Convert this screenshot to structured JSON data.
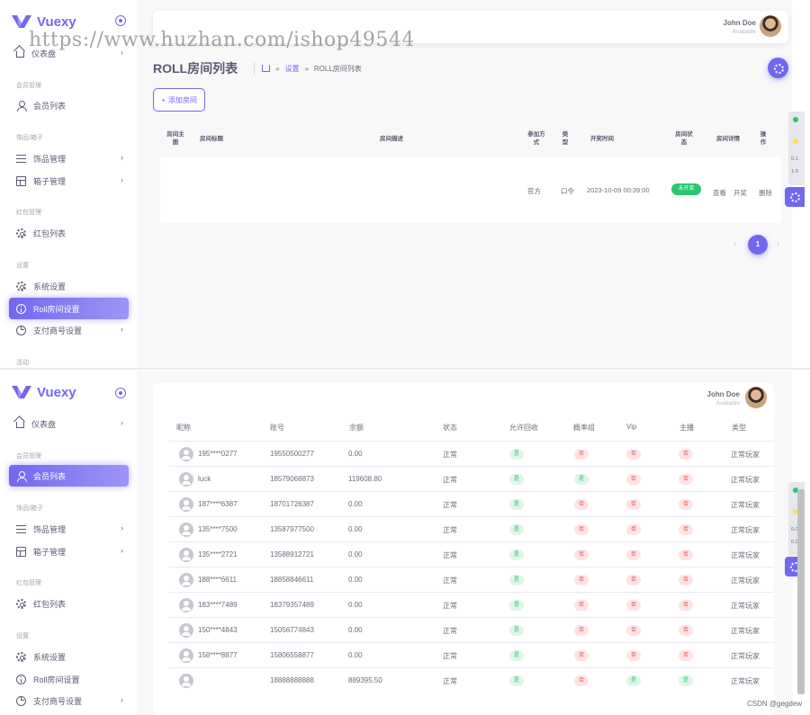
{
  "brand": {
    "name": "Vuexy",
    "color": "#7367f0"
  },
  "watermark": "https://www.huzhan.com/ishop49544",
  "csdn_mark": "CSDN @gegdew",
  "user": {
    "name": "John Doe",
    "status": "Available"
  },
  "top_panel": {
    "sidebar": {
      "dashboard": "仪表盘",
      "sections": {
        "members": "会员管理",
        "goods": "饰品/箱子",
        "redpack": "红包管理",
        "settings": "设置"
      },
      "items": {
        "member_list": "会员列表",
        "goods_manage": "饰品管理",
        "box_manage": "箱子管理",
        "redpack_list": "红包列表",
        "system_settings": "系统设置",
        "roll_settings": "Roll房间设置",
        "payment_settings": "支付商号设置"
      },
      "trailing_section": "活动"
    },
    "page_title": "ROLL房间列表",
    "breadcrumb": {
      "link": "设置",
      "current": "ROLL房间列表"
    },
    "add_button": "添加房间",
    "table": {
      "headers": {
        "owner": "房间主图",
        "title": "房间标题",
        "desc": "房间描述",
        "mode": "参加方式",
        "type": "类型",
        "time": "开奖时间",
        "status": "房间状态",
        "detail": "房间详情",
        "ops": "操作"
      },
      "row": {
        "mode": "官方",
        "type": "口令",
        "time": "2023-10-09 00:39:00",
        "status": "未开奖",
        "ops": {
          "view": "查看",
          "draw": "开奖",
          "delete": "删除"
        }
      }
    },
    "pagination": {
      "current": "1",
      "prev": "‹",
      "next": "›"
    },
    "side_tools": {
      "nums": [
        "0.1",
        "1.0"
      ]
    }
  },
  "bottom_panel": {
    "sidebar": {
      "dashboard": "仪表盘",
      "sections": {
        "members": "会员管理",
        "goods": "饰品/箱子",
        "redpack": "红包管理",
        "settings": "设置"
      },
      "items": {
        "member_list": "会员列表",
        "goods_manage": "饰品管理",
        "box_manage": "箱子管理",
        "redpack_list": "红包列表",
        "system_settings": "系统设置",
        "roll_settings": "Roll房间设置",
        "payment_settings": "支付商号设置"
      }
    },
    "table": {
      "headers": {
        "nick": "昵称",
        "account": "账号",
        "balance": "余额",
        "status": "状态",
        "allow_recycle": "允许回收",
        "odds_group": "概率组",
        "vip": "Vip",
        "anchor": "主播",
        "type": "类型"
      },
      "rows": [
        {
          "nick": "195****0277",
          "account": "19550500277",
          "balance": "0.00",
          "status": "正常",
          "recycle": "是",
          "odds": "否",
          "vip": "否",
          "anchor": "否",
          "type": "正常玩家"
        },
        {
          "nick": "luck",
          "account": "18579068873",
          "balance": "119608.80",
          "status": "正常",
          "recycle": "是",
          "odds": "是",
          "vip": "否",
          "anchor": "否",
          "type": "正常玩家"
        },
        {
          "nick": "187****6387",
          "account": "18701726387",
          "balance": "0.00",
          "status": "正常",
          "recycle": "是",
          "odds": "否",
          "vip": "否",
          "anchor": "否",
          "type": "正常玩家"
        },
        {
          "nick": "135****7500",
          "account": "13587977500",
          "balance": "0.00",
          "status": "正常",
          "recycle": "是",
          "odds": "否",
          "vip": "否",
          "anchor": "否",
          "type": "正常玩家"
        },
        {
          "nick": "135****2721",
          "account": "13588912721",
          "balance": "0.00",
          "status": "正常",
          "recycle": "是",
          "odds": "否",
          "vip": "否",
          "anchor": "否",
          "type": "正常玩家"
        },
        {
          "nick": "188****6611",
          "account": "18858846611",
          "balance": "0.00",
          "status": "正常",
          "recycle": "是",
          "odds": "否",
          "vip": "否",
          "anchor": "否",
          "type": "正常玩家"
        },
        {
          "nick": "183****7489",
          "account": "18379357489",
          "balance": "0.00",
          "status": "正常",
          "recycle": "是",
          "odds": "否",
          "vip": "否",
          "anchor": "否",
          "type": "正常玩家"
        },
        {
          "nick": "150****4843",
          "account": "15056774843",
          "balance": "0.00",
          "status": "正常",
          "recycle": "是",
          "odds": "否",
          "vip": "否",
          "anchor": "否",
          "type": "正常玩家"
        },
        {
          "nick": "158****8877",
          "account": "15806558877",
          "balance": "0.00",
          "status": "正常",
          "recycle": "是",
          "odds": "否",
          "vip": "否",
          "anchor": "否",
          "type": "正常玩家"
        },
        {
          "nick": "",
          "account": "18888888888",
          "balance": "889395.50",
          "status": "正常",
          "recycle": "是",
          "odds": "否",
          "vip": "是",
          "anchor": "是",
          "type": "正常玩家"
        }
      ]
    },
    "side_tools": {
      "nums": [
        "0.0",
        "0.0"
      ]
    }
  },
  "colors": {
    "accent": "#7367f0",
    "success": "#28c76f",
    "danger": "#ea5455"
  }
}
